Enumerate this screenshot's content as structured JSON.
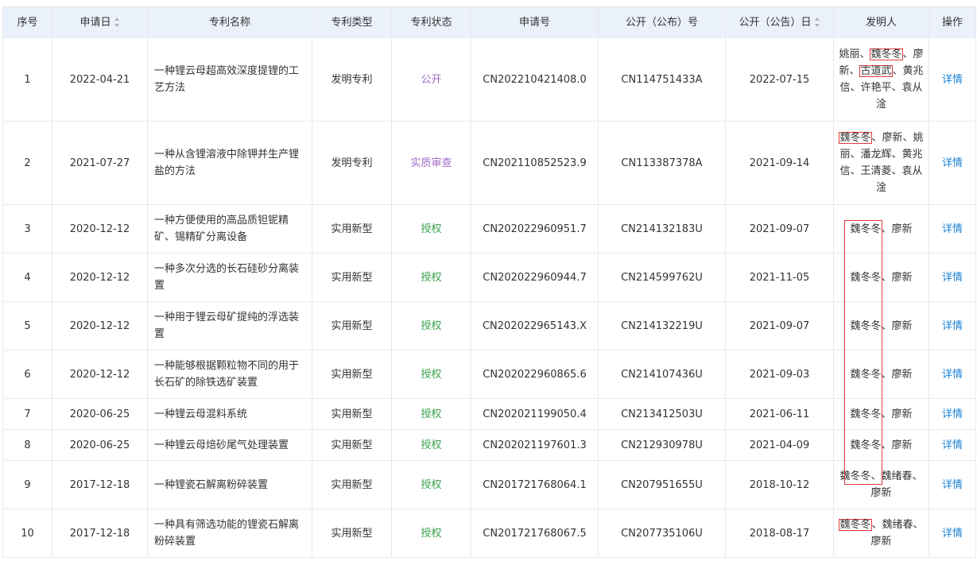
{
  "headers": {
    "no": "序号",
    "apply_date": "申请日",
    "name": "专利名称",
    "type": "专利类型",
    "status": "专利状态",
    "app_no": "申请号",
    "pub_no": "公开（公布）号",
    "pub_date": "公开（公告）日",
    "inventors": "发明人",
    "action": "操作"
  },
  "status_colors": {
    "公开": "#a06bc7",
    "实质审查": "#a06bc7",
    "授权": "#3aa14a"
  },
  "detail_label": "详情",
  "rows": [
    {
      "no": "1",
      "apply_date": "2022-04-21",
      "name": "一种锂云母超高效深度提锂的工艺方法",
      "type": "发明专利",
      "status": "公开",
      "status_class": "st-purple",
      "app_no": "CN202210421408.0",
      "pub_no": "CN114751433A",
      "pub_date": "2022-07-15",
      "inventors": [
        {
          "t": "姚丽、"
        },
        {
          "t": "魏冬冬",
          "hl": true
        },
        {
          "t": "、廖新、"
        },
        {
          "t": "古道武",
          "hl": true
        },
        {
          "t": "、黄兆信、许艳平、袁从淦"
        }
      ]
    },
    {
      "no": "2",
      "apply_date": "2021-07-27",
      "name": "一种从含锂溶液中除钾并生产锂盐的方法",
      "type": "发明专利",
      "status": "实质审查",
      "status_class": "st-purple",
      "app_no": "CN202110852523.9",
      "pub_no": "CN113387378A",
      "pub_date": "2021-09-14",
      "inventors": [
        {
          "t": "魏冬冬",
          "hl": true
        },
        {
          "t": "、廖新、姚丽、潘龙辉、黄兆信、王清菱、袁从淦"
        }
      ]
    },
    {
      "no": "3",
      "apply_date": "2020-12-12",
      "name": "一种方便使用的高品质钽铌精矿、锡精矿分离设备",
      "type": "实用新型",
      "status": "授权",
      "status_class": "st-green",
      "app_no": "CN202022960951.7",
      "pub_no": "CN214132183U",
      "pub_date": "2021-09-07",
      "inventors": [
        {
          "t": "魏冬冬"
        },
        {
          "t": "、廖新"
        }
      ]
    },
    {
      "no": "4",
      "apply_date": "2020-12-12",
      "name": "一种多次分选的长石硅砂分离装置",
      "type": "实用新型",
      "status": "授权",
      "status_class": "st-green",
      "app_no": "CN202022960944.7",
      "pub_no": "CN214599762U",
      "pub_date": "2021-11-05",
      "inventors": [
        {
          "t": "魏冬冬"
        },
        {
          "t": "、廖新"
        }
      ]
    },
    {
      "no": "5",
      "apply_date": "2020-12-12",
      "name": "一种用于锂云母矿提纯的浮选装置",
      "type": "实用新型",
      "status": "授权",
      "status_class": "st-green",
      "app_no": "CN202022965143.X",
      "pub_no": "CN214132219U",
      "pub_date": "2021-09-07",
      "inventors": [
        {
          "t": "魏冬冬"
        },
        {
          "t": "、廖新"
        }
      ]
    },
    {
      "no": "6",
      "apply_date": "2020-12-12",
      "name": "一种能够根据颗粒物不同的用于长石矿的除铁选矿装置",
      "type": "实用新型",
      "status": "授权",
      "status_class": "st-green",
      "app_no": "CN202022960865.6",
      "pub_no": "CN214107436U",
      "pub_date": "2021-09-03",
      "inventors": [
        {
          "t": "魏冬冬"
        },
        {
          "t": "、廖新"
        }
      ]
    },
    {
      "no": "7",
      "apply_date": "2020-06-25",
      "name": "一种锂云母混料系统",
      "type": "实用新型",
      "status": "授权",
      "status_class": "st-green",
      "app_no": "CN202021199050.4",
      "pub_no": "CN213412503U",
      "pub_date": "2021-06-11",
      "inventors": [
        {
          "t": "魏冬冬"
        },
        {
          "t": "、廖新"
        }
      ]
    },
    {
      "no": "8",
      "apply_date": "2020-06-25",
      "name": "一种锂云母焙砂尾气处理装置",
      "type": "实用新型",
      "status": "授权",
      "status_class": "st-green",
      "app_no": "CN202021197601.3",
      "pub_no": "CN212930978U",
      "pub_date": "2021-04-09",
      "inventors": [
        {
          "t": "魏冬冬"
        },
        {
          "t": "、廖新"
        }
      ]
    },
    {
      "no": "9",
      "apply_date": "2017-12-18",
      "name": "一种锂瓷石解离粉碎装置",
      "type": "实用新型",
      "status": "授权",
      "status_class": "st-green",
      "app_no": "CN201721768064.1",
      "pub_no": "CN207951655U",
      "pub_date": "2018-10-12",
      "inventors": [
        {
          "t": "魏冬冬"
        },
        {
          "t": "、魏绪春、廖新"
        }
      ]
    },
    {
      "no": "10",
      "apply_date": "2017-12-18",
      "name": "一种具有筛选功能的锂瓷石解离粉碎装置",
      "type": "实用新型",
      "status": "授权",
      "status_class": "st-green",
      "app_no": "CN201721768067.5",
      "pub_no": "CN207735106U",
      "pub_date": "2018-08-17",
      "inventors": [
        {
          "t": "魏冬冬",
          "hl": true
        },
        {
          "t": "、魏绪春、廖新"
        }
      ]
    }
  ]
}
